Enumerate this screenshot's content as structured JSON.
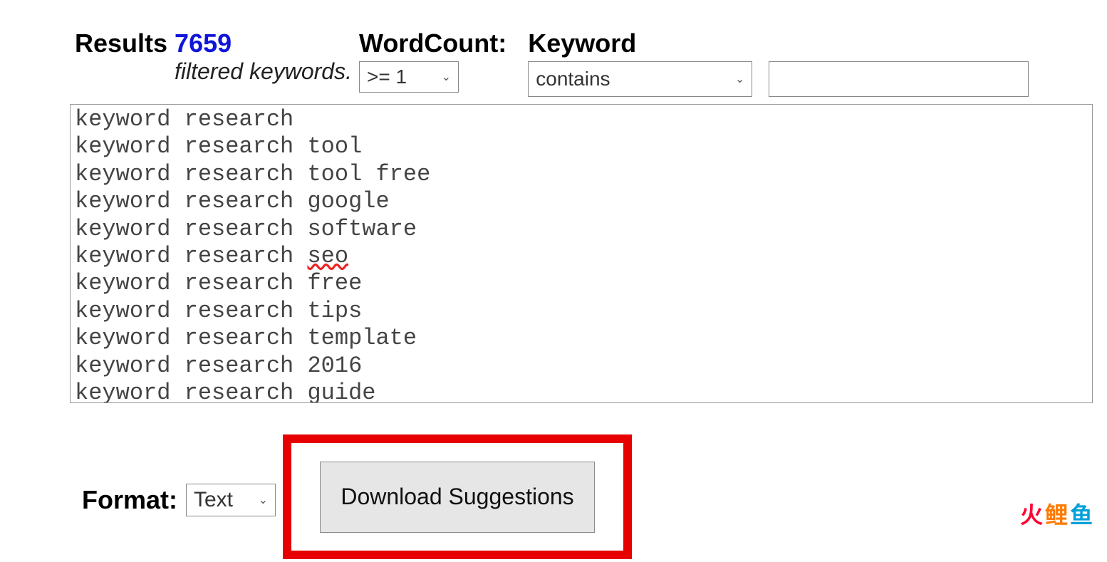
{
  "header": {
    "results_label": "Results",
    "results_count": "7659",
    "filtered_label": "filtered keywords.",
    "wordcount_label": "WordCount:",
    "keyword_label": "Keyword"
  },
  "controls": {
    "wordcount_select": ">= 1",
    "keyword_mode": "contains",
    "keyword_input": ""
  },
  "results": {
    "lines": [
      "keyword research",
      "keyword research tool",
      "keyword research tool free",
      "keyword research google",
      "keyword research software",
      "keyword research seo",
      "keyword research free",
      "keyword research tips",
      "keyword research template",
      "keyword research 2016",
      "keyword research guide"
    ],
    "spellcheck_index": 5,
    "spellcheck_word": "seo"
  },
  "footer": {
    "format_label": "Format:",
    "format_select": "Text",
    "download_label": "Download Suggestions"
  },
  "watermark": {
    "a": "火",
    "b": "鲤",
    "c": "鱼"
  }
}
